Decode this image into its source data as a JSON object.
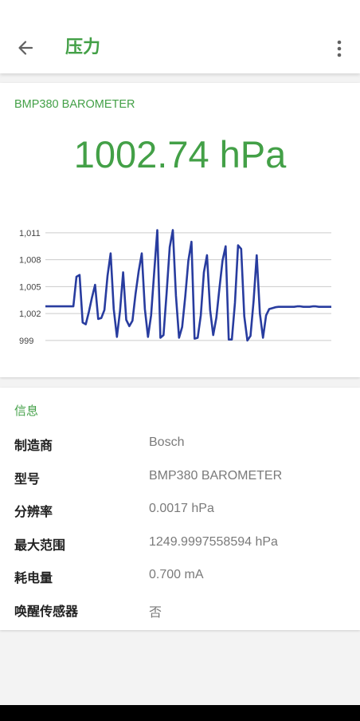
{
  "app_bar": {
    "title": "压力",
    "back_icon": "arrow-back-icon",
    "menu_icon": "more-vert-icon"
  },
  "colors": {
    "accent": "#43a047",
    "chart_line": "#283c9f",
    "grid": "#cccccc"
  },
  "sensor": {
    "name": "BMP380 BAROMETER",
    "reading": "1002.74 hPa"
  },
  "chart_data": {
    "type": "line",
    "title": "",
    "xlabel": "",
    "ylabel": "",
    "ylim": [
      997.3,
      1011.7
    ],
    "y_ticks": [
      999,
      1002,
      1005,
      1008,
      1011
    ],
    "y_tick_labels": [
      "999",
      "1,002",
      "1,005",
      "1,008",
      "1,011"
    ],
    "grid": true,
    "series": [
      {
        "values": [
          1002.8,
          1002.8,
          1002.8,
          1002.8,
          1002.8,
          1002.8,
          1002.8,
          1002.8,
          1002.8,
          1002.8,
          1006.1,
          1006.3,
          1001.0,
          1000.8,
          1002.2,
          1003.8,
          1005.2,
          1001.4,
          1001.5,
          1002.4,
          1006.2,
          1008.7,
          1002.5,
          999.4,
          1002.3,
          1006.6,
          1001.3,
          1000.6,
          1001.2,
          1004.2,
          1006.7,
          1008.7,
          1002.5,
          999.4,
          1001.8,
          1006.6,
          1011.3,
          999.3,
          999.6,
          1004.3,
          1009.4,
          1011.3,
          1004.0,
          999.3,
          1000.5,
          1003.9,
          1007.9,
          1010.0,
          999.2,
          999.3,
          1001.8,
          1006.6,
          1008.5,
          1002.4,
          999.6,
          1001.5,
          1004.8,
          1007.9,
          1009.5,
          999.1,
          999.1,
          1003.2,
          1009.6,
          1009.2,
          1001.7,
          999.0,
          999.5,
          1003.4,
          1008.5,
          1002.0,
          999.3,
          1001.8,
          1002.5,
          1002.6,
          1002.7,
          1002.75,
          1002.75,
          1002.75,
          1002.75,
          1002.75,
          1002.75,
          1002.8,
          1002.8,
          1002.75,
          1002.75,
          1002.75,
          1002.8,
          1002.8,
          1002.75,
          1002.75,
          1002.75,
          1002.75,
          1002.75
        ]
      }
    ]
  },
  "info": {
    "header": "信息",
    "rows": [
      {
        "label": "制造商",
        "value": "Bosch"
      },
      {
        "label": "型号",
        "value": "BMP380 BAROMETER"
      },
      {
        "label": "分辨率",
        "value": "0.0017 hPa"
      },
      {
        "label": "最大范围",
        "value": "1249.9997558594 hPa"
      },
      {
        "label": "耗电量",
        "value": "0.700 mA"
      },
      {
        "label": "唤醒传感器",
        "value": "否"
      }
    ]
  }
}
